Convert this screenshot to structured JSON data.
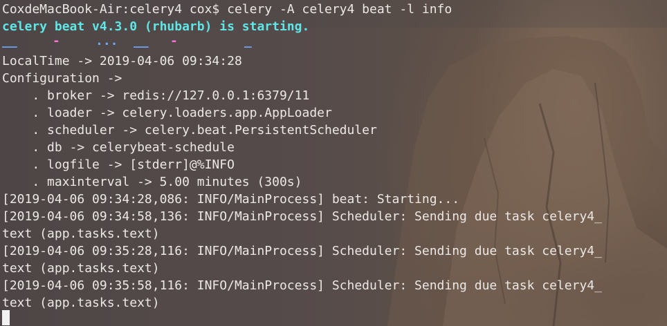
{
  "terminal": {
    "prompt_line": "CoxdeMacBook-Air:celery4 cox$ celery -A celery4 beat -l info",
    "starting_line": "celery beat v4.3.0 (rhubarb) is starting.",
    "banner": [
      {
        "text": "__",
        "color": "#6fa8ff"
      },
      {
        "text": "-",
        "color": "#ff6fd6"
      },
      {
        "text": "...",
        "color": "#6fa8ff"
      },
      {
        "text": "__",
        "color": "#6fa8ff"
      },
      {
        "text": "-",
        "color": "#ff6fd6"
      },
      {
        "text": "_",
        "color": "#6fa8ff"
      }
    ],
    "output_lines": [
      "LocalTime -> 2019-04-06 09:34:28",
      "Configuration ->",
      "    . broker -> redis://127.0.0.1:6379/11",
      "    . loader -> celery.loaders.app.AppLoader",
      "    . scheduler -> celery.beat.PersistentScheduler",
      "    . db -> celerybeat-schedule",
      "    . logfile -> [stderr]@%INFO",
      "    . maxinterval -> 5.00 minutes (300s)",
      "[2019-04-06 09:34:28,086: INFO/MainProcess] beat: Starting...",
      "[2019-04-06 09:34:58,136: INFO/MainProcess] Scheduler: Sending due task celery4_",
      "text (app.tasks.text)",
      "[2019-04-06 09:35:28,116: INFO/MainProcess] Scheduler: Sending due task celery4_",
      "text (app.tasks.text)",
      "[2019-04-06 09:35:58,116: INFO/MainProcess] Scheduler: Sending due task celery4_",
      "text (app.tasks.text)"
    ],
    "colors": {
      "text": "#ece8e6",
      "highlight": "#5fe6e6",
      "cursor": "#f2f2f2"
    }
  }
}
